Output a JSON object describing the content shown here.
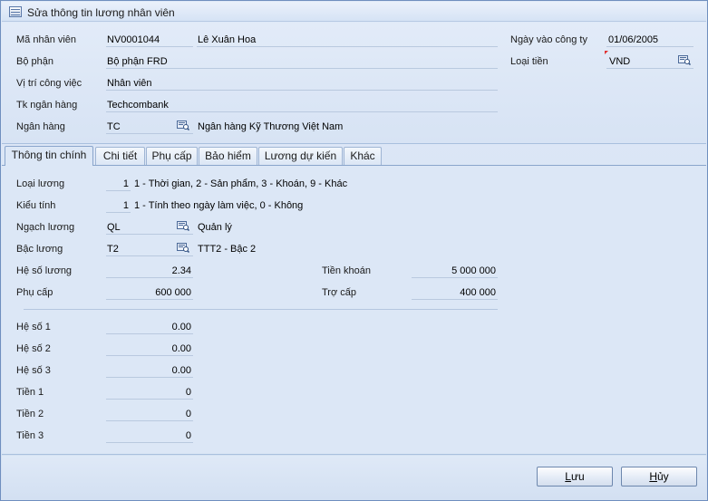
{
  "window": {
    "title": "Sửa thông tin lương nhân viên",
    "icon": "form-icon"
  },
  "header": {
    "employee_id_label": "Mã nhân viên",
    "employee_id": "NV0001044",
    "employee_name": "Lê Xuân Hoa",
    "department_label": "Bộ phận",
    "department": "Bộ phận FRD",
    "position_label": "Vị trí công việc",
    "position": "Nhân viên",
    "bank_account_label": "Tk ngân hàng",
    "bank_account": "Techcombank",
    "bank_label": "Ngân hàng",
    "bank_code": "TC",
    "bank_name": "Ngân hàng Kỹ Thương Việt Nam",
    "join_date_label": "Ngày vào công ty",
    "join_date": "01/06/2005",
    "currency_label": "Loại tiền",
    "currency": "VND"
  },
  "tabs": [
    {
      "label": "Thông tin chính",
      "active": true
    },
    {
      "label": "Chi tiết",
      "active": false
    },
    {
      "label": "Phụ cấp",
      "active": false
    },
    {
      "label": "Bảo hiểm",
      "active": false
    },
    {
      "label": "Lương dự kiến",
      "active": false
    },
    {
      "label": "Khác",
      "active": false
    }
  ],
  "main": {
    "salary_type_label": "Loại lương",
    "salary_type": "1",
    "salary_type_hint": "1 - Thời gian, 2 - Sản phẩm, 3 - Khoán, 9 - Khác",
    "calc_type_label": "Kiểu tính",
    "calc_type": "1",
    "calc_type_hint": "1 - Tính theo ngày làm việc, 0 - Không",
    "pay_grade_label": "Ngạch lương",
    "pay_grade": "QL",
    "pay_grade_name": "Quản lý",
    "pay_level_label": "Bậc lương",
    "pay_level": "T2",
    "pay_level_name": "TTT2 - Bậc 2",
    "coefficient_label": "Hệ số lương",
    "coefficient": "2.34",
    "allowance_label": "Phụ cấp",
    "allowance": "600 000",
    "lump_sum_label": "Tiền khoán",
    "lump_sum": "5 000 000",
    "subsidy_label": "Trợ cấp",
    "subsidy": "400 000",
    "extra": [
      {
        "label": "Hệ số 1",
        "value": "0.00"
      },
      {
        "label": "Hệ số 2",
        "value": "0.00"
      },
      {
        "label": "Hệ số 3",
        "value": "0.00"
      },
      {
        "label": "Tiền 1",
        "value": "0"
      },
      {
        "label": "Tiền 2",
        "value": "0"
      },
      {
        "label": "Tiền 3",
        "value": "0"
      }
    ]
  },
  "footer": {
    "save_hotkey": "L",
    "save_rest": "ưu",
    "cancel_hotkey": "H",
    "cancel_rest": "ủy"
  },
  "colors": {
    "window_bg": "#d3e0f2",
    "border": "#6f8fbf",
    "required_marker": "#e03030"
  }
}
